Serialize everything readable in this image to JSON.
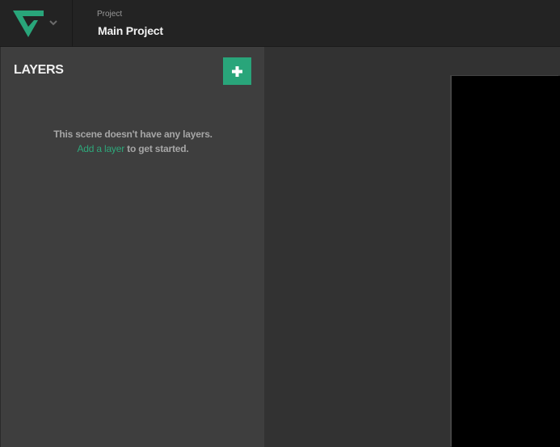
{
  "header": {
    "logo_icon": "triangle-logo-icon",
    "menu_icon": "chevron-down-icon",
    "project_caption": "Project",
    "project_name": "Main Project"
  },
  "layers_panel": {
    "title": "LAYERS",
    "add_button_icon": "plus-icon",
    "empty_message": "This scene doesn't have any layers.",
    "add_link_text": "Add a layer",
    "add_link_suffix": " to get started."
  },
  "colors": {
    "accent": "#29a57a",
    "header_bg": "#232323",
    "panel_bg": "#3e3e3e",
    "canvas_bg": "#323232",
    "stage_bg": "#000000"
  }
}
